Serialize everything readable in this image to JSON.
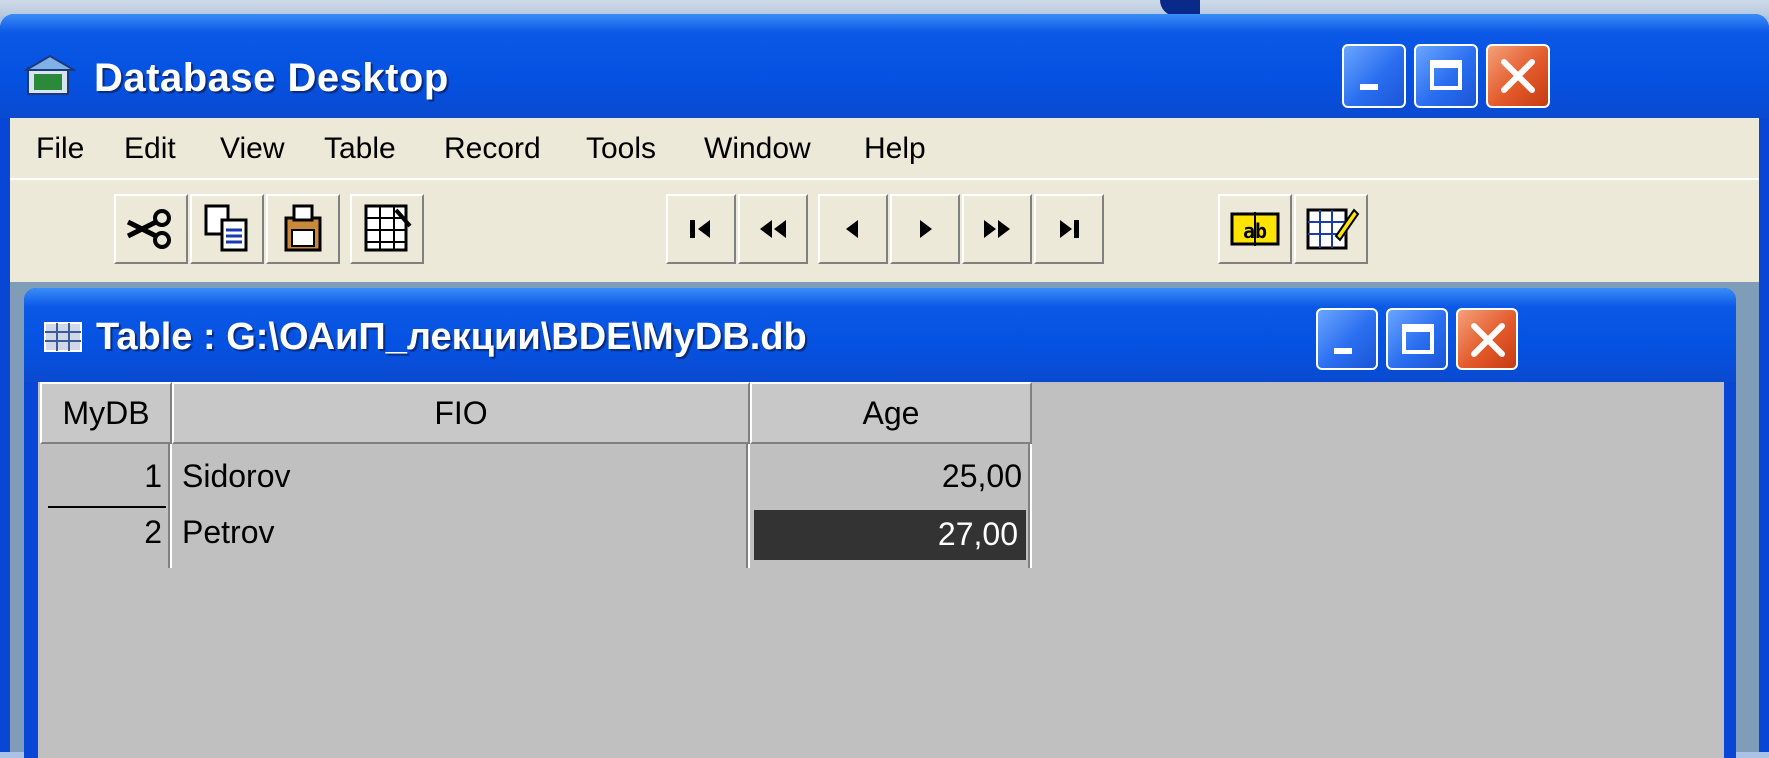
{
  "app": {
    "title": "Database Desktop"
  },
  "menu": [
    "File",
    "Edit",
    "View",
    "Table",
    "Record",
    "Tools",
    "Window",
    "Help"
  ],
  "toolbar": {
    "edit_tools": [
      "scissors-icon",
      "copy-icon",
      "paste-icon",
      "table-properties-icon"
    ],
    "navigation": [
      "first-record-icon",
      "prior-set-icon",
      "prior-record-icon",
      "next-record-icon",
      "next-set-icon",
      "last-record-icon"
    ],
    "field_tools": [
      "field-view-icon",
      "edit-data-icon"
    ]
  },
  "table_window": {
    "title": "Table : G:\\ОАиП_лекции\\BDE\\MyDB.db",
    "columns": [
      "MyDB",
      "FIO",
      "Age"
    ],
    "rows": [
      {
        "num": "1",
        "fio": "Sidorov",
        "age": "25,00"
      },
      {
        "num": "2",
        "fio": "Petrov",
        "age": "27,00"
      }
    ],
    "selected": {
      "row": 2,
      "column": "Age"
    }
  },
  "colors": {
    "xp_blue": "#0552e2",
    "close_red": "#e35a2a",
    "face": "#ece9d8",
    "grid_bg": "#c0c0c0",
    "selection": "#333333"
  }
}
